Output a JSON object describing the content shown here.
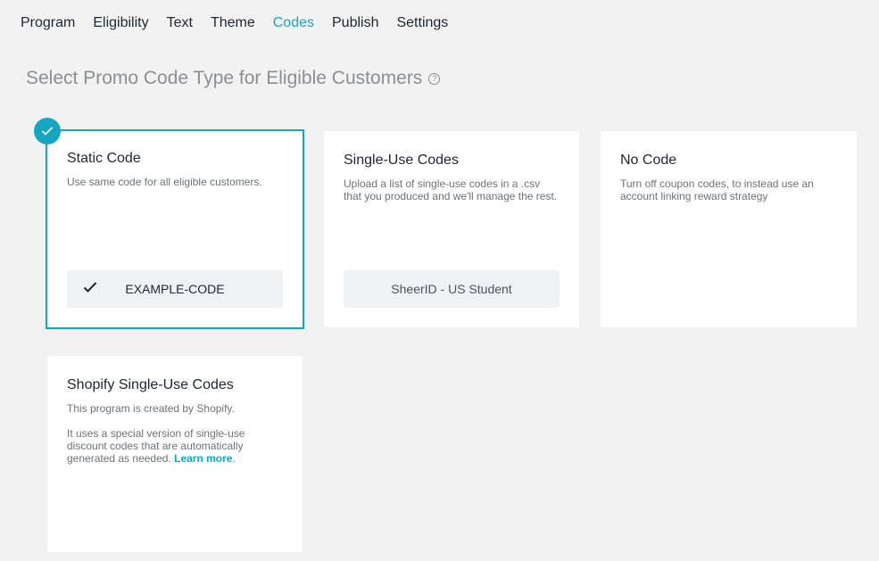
{
  "nav": {
    "items": [
      {
        "label": "Program"
      },
      {
        "label": "Eligibility"
      },
      {
        "label": "Text"
      },
      {
        "label": "Theme"
      },
      {
        "label": "Codes",
        "active": true
      },
      {
        "label": "Publish"
      },
      {
        "label": "Settings"
      }
    ]
  },
  "page": {
    "title": "Select Promo Code Type for Eligible Customers",
    "help_icon_glyph": "?"
  },
  "cards": {
    "static": {
      "title": "Static Code",
      "description": "Use same code for all eligible customers.",
      "code": "EXAMPLE-CODE",
      "selected": true
    },
    "single_use": {
      "title": "Single-Use Codes",
      "description": "Upload a list of single-use codes in a .csv that you produced and we'll manage the rest.",
      "code": "SheerID - US Student"
    },
    "no_code": {
      "title": "No Code",
      "description": "Turn off coupon codes, to instead use an account linking reward strategy"
    },
    "shopify": {
      "title": "Shopify Single-Use Codes",
      "description_1": "This program is created by Shopify.",
      "description_2": "It uses a special version of single-use discount codes that are automatically generated as needed.",
      "link_text": "Learn more",
      "link_suffix": "."
    }
  },
  "colors": {
    "accent": "#15a6c1",
    "background": "#f2f2f2",
    "card": "#ffffff",
    "text": "#1d2733",
    "muted_text": "#8a8f94"
  },
  "icons": {
    "selected_badge": "check-icon",
    "pill_check": "check-icon",
    "help": "question-circle-icon"
  }
}
